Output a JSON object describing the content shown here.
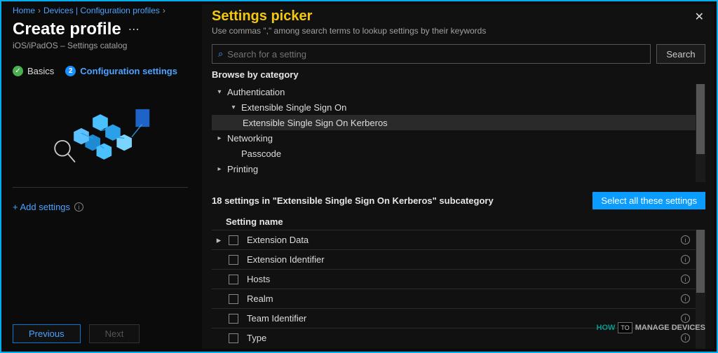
{
  "breadcrumb": {
    "home": "Home",
    "devices": "Devices | Configuration profiles"
  },
  "page": {
    "title": "Create profile",
    "subtitle": "iOS/iPadOS – Settings catalog"
  },
  "tabs": {
    "basics": "Basics",
    "config": "Configuration settings"
  },
  "add_settings_label": "+ Add settings",
  "footer": {
    "previous": "Previous",
    "next": "Next"
  },
  "picker": {
    "title": "Settings picker",
    "subtitle": "Use commas \",\" among search terms to lookup settings by their keywords",
    "search_placeholder": "Search for a setting",
    "search_btn": "Search",
    "browse_label": "Browse by category",
    "categories": {
      "authentication": "Authentication",
      "esso": "Extensible Single Sign On",
      "esso_kerberos": "Extensible Single Sign On Kerberos",
      "networking": "Networking",
      "passcode": "Passcode",
      "printing": "Printing"
    },
    "subcategory_line": "18 settings in \"Extensible Single Sign On Kerberos\" subcategory",
    "select_all": "Select all these settings",
    "setting_name_header": "Setting name",
    "settings": [
      "Extension Data",
      "Extension Identifier",
      "Hosts",
      "Realm",
      "Team Identifier",
      "Type"
    ]
  },
  "watermark": {
    "how": "HOW",
    "to": "TO",
    "rest": "MANAGE DEVICES"
  }
}
